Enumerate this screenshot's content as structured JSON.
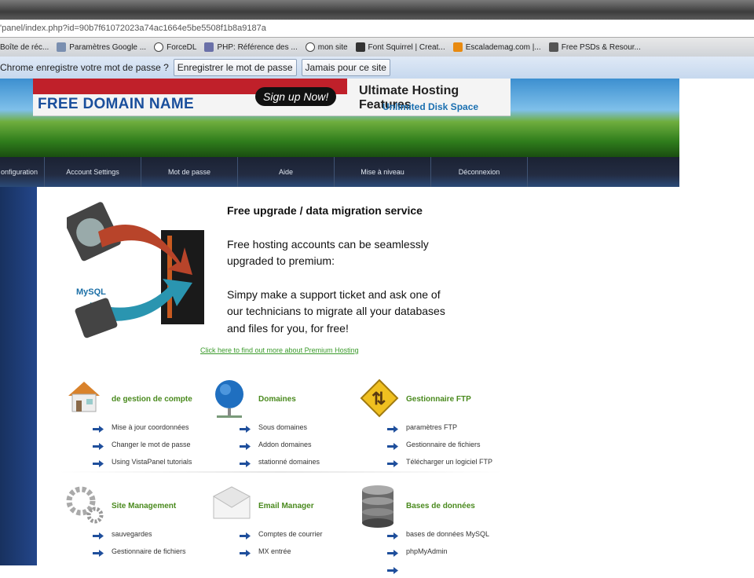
{
  "browser": {
    "url": "'panel/index.php?id=90b7f61072023a74ac1664e5be5508f1b8a9187a",
    "bookmarks": [
      "Boîte de réc...",
      "Paramètres Google ...",
      "ForceDL",
      "PHP: Référence des ...",
      "mon site",
      "Font Squirrel | Creat...",
      "Escalademag.com |...",
      "Free PSDs & Resour..."
    ],
    "password_bar": {
      "message": "Chrome enregistre votre mot de passe ?",
      "save_label": "Enregistrer le mot de passe",
      "never_label": "Jamais pour ce site"
    }
  },
  "ad": {
    "headline": "FREE DOMAIN NAME",
    "signup": "Sign up Now!",
    "features": "Ultimate Hosting Features",
    "disk": "Unlimited Disk Space"
  },
  "nav": [
    "onfiguration",
    "Account Settings",
    "Mot de passe",
    "Aide",
    "Mise à niveau",
    "Déconnexion"
  ],
  "migration": {
    "title": "Free upgrade / data migration service",
    "p1": "Free hosting accounts can be seamlessly upgraded to premium:",
    "p2": "Simpy make a support ticket and ask one of our technicians to migrate all your databases and files for you, for free!",
    "link": "Click here to find out more about Premium Hosting",
    "mysql_label": "MySQL"
  },
  "sections": [
    {
      "title": "de gestion de compte",
      "icon": "house-icon",
      "items": [
        "Mise à jour coordonnées",
        "Changer le mot de passe",
        "Using VistaPanel tutorials"
      ]
    },
    {
      "title": "Domaines",
      "icon": "globe-icon",
      "items": [
        "Sous domaines",
        "Addon domaines",
        "stationné domaines"
      ]
    },
    {
      "title": "Gestionnaire FTP",
      "icon": "ftp-sign-icon",
      "items": [
        "paramètres FTP",
        "Gestionnaire de fichiers",
        "Télécharger un logiciel FTP"
      ]
    },
    {
      "title": "Site Management",
      "icon": "gears-icon",
      "items": [
        "sauvegardes",
        "Gestionnaire de fichiers"
      ]
    },
    {
      "title": "Email Manager",
      "icon": "envelope-icon",
      "items": [
        "Comptes de courrier",
        "MX entrée"
      ]
    },
    {
      "title": "Bases de données",
      "icon": "database-icon",
      "items": [
        "bases de données MySQL",
        "phpMyAdmin"
      ]
    }
  ]
}
